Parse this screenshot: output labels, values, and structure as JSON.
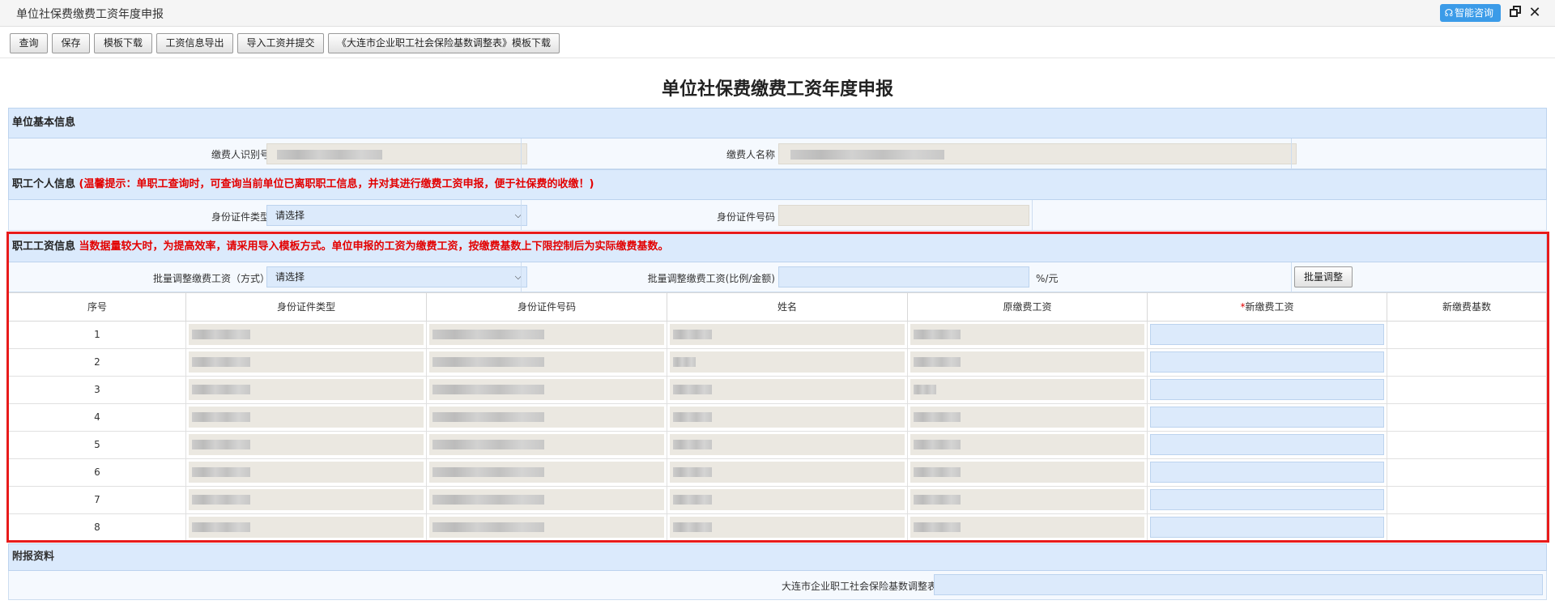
{
  "window": {
    "title": "单位社保费缴费工资年度申报",
    "smart_consult": "智能咨询",
    "icons": {
      "headset": "headset-icon",
      "restore": "restore-icon",
      "close": "close-icon"
    }
  },
  "toolbar": {
    "buttons": [
      "查询",
      "保存",
      "模板下载",
      "工资信息导出",
      "导入工资并提交",
      "《大连市企业职工社会保险基数调整表》模板下载"
    ]
  },
  "page_title": "单位社保费缴费工资年度申报",
  "unit_info": {
    "section_title": "单位基本信息",
    "payer_id_label": "缴费人识别号",
    "payer_name_label": "缴费人名称"
  },
  "personal_info": {
    "section_title": "职工个人信息",
    "tip": "(温馨提示：单职工查询时，可查询当前单位已离职职工信息，并对其进行缴费工资申报，便于社保费的收缴！)",
    "id_type_label": "身份证件类型",
    "id_type_value": "请选择",
    "id_number_label": "身份证件号码"
  },
  "wage_info": {
    "section_title": "职工工资信息",
    "tip": "当数据量较大时，为提高效率，请采用导入模板方式。单位申报的工资为缴费工资，按缴费基数上下限控制后为实际缴费基数。",
    "batch_mode_label": "批量调整缴费工资（方式）",
    "batch_mode_value": "请选择",
    "batch_amount_label": "批量调整缴费工资(比例/金额)",
    "batch_amount_unit": "%/元",
    "batch_button": "批量调整",
    "columns": [
      "序号",
      "身份证件类型",
      "身份证件号码",
      "姓名",
      "原缴费工资",
      "新缴费工资",
      "新缴费基数"
    ],
    "required_mark": "*",
    "rows": [
      "1",
      "2",
      "3",
      "4",
      "5",
      "6",
      "7",
      "8"
    ]
  },
  "attachments": {
    "section_title": "附报资料",
    "file_label": "大连市企业职工社会保险基数调整表"
  },
  "colors": {
    "accent": "#3b9be8",
    "section_bg": "#dbeafc",
    "warning": "#e30000",
    "highlight_border": "#e81b1b"
  }
}
